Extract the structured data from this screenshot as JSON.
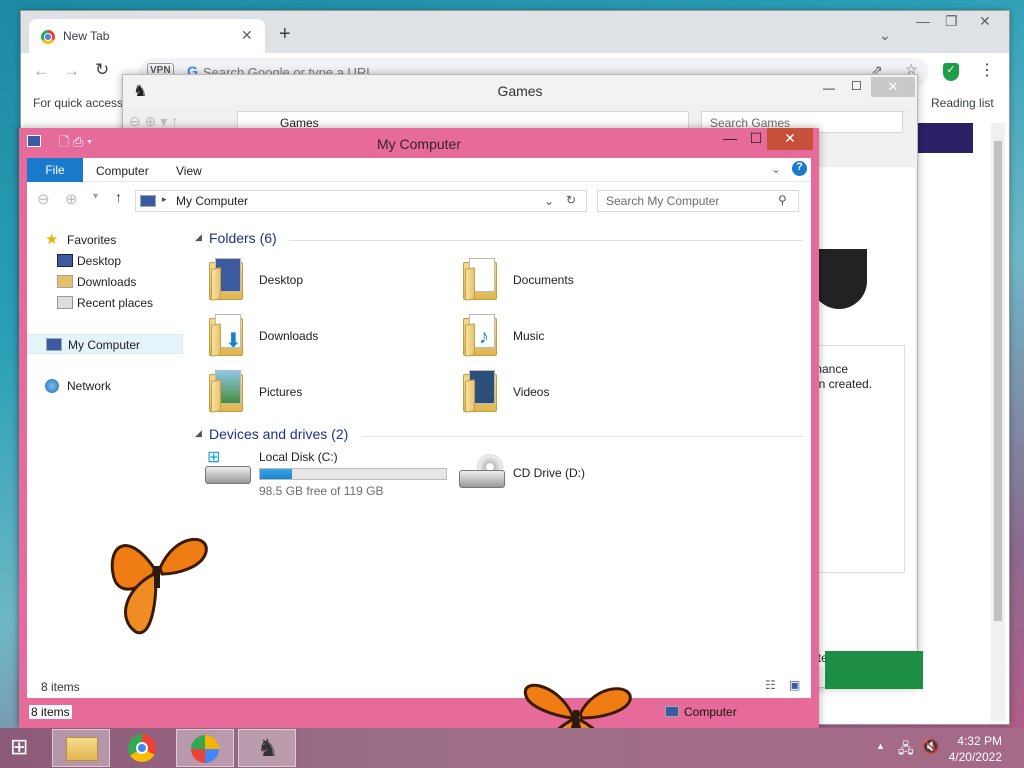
{
  "chrome": {
    "tab_title": "New Tab",
    "omnibox_prefix": "VPN",
    "omnibox_placeholder": "Search Google or type a URL",
    "bookmark_quick": "For quick access,",
    "bookmark_reading": "Reading list"
  },
  "games": {
    "title": "Games",
    "address": "Games",
    "search_placeholder": "Search Games",
    "snippet_1": "mance",
    "snippet_2": "en created.",
    "snippet_3": "uter"
  },
  "mycomputer": {
    "title": "My Computer",
    "ribbon": {
      "file": "File",
      "computer": "Computer",
      "view": "View"
    },
    "address": "My Computer",
    "search_placeholder": "Search My Computer",
    "sidebar": {
      "favorites": "Favorites",
      "desktop": "Desktop",
      "downloads": "Downloads",
      "recent": "Recent places",
      "mycomputer": "My Computer",
      "network": "Network"
    },
    "folders_header": "Folders (6)",
    "folders": [
      "Desktop",
      "Documents",
      "Downloads",
      "Music",
      "Pictures",
      "Videos"
    ],
    "devices_header": "Devices and drives (2)",
    "drive_c": {
      "name": "Local Disk (C:)",
      "free": "98.5 GB free of 119 GB",
      "used_fraction": 0.17
    },
    "drive_d": {
      "name": "CD Drive (D:)"
    },
    "status_inner": "8 items",
    "status_outer": "8 items",
    "status_location": "Computer"
  },
  "taskbar": {
    "time": "4:32 PM",
    "date": "4/20/2022"
  }
}
